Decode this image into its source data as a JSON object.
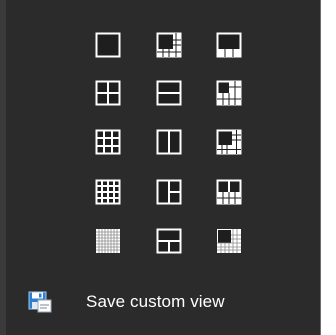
{
  "layout_menu": {
    "rows": [
      [
        "single-view-layout-icon",
        "one-plus-five-layout-icon",
        "one-plus-three-layout-icon"
      ],
      [
        "quad-grid-layout-icon",
        "horizontal-split-layout-icon",
        "one-plus-seven-layout-icon"
      ],
      [
        "nine-grid-layout-icon",
        "vertical-split-layout-icon",
        "one-plus-twelve-layout-icon"
      ],
      [
        "sixteen-grid-layout-icon",
        "left-large-split-layout-icon",
        "two-plus-eight-layout-icon"
      ],
      [
        "sixty-four-grid-layout-icon",
        "top-large-split-layout-icon",
        "one-plus-fifteen-layout-icon"
      ]
    ]
  },
  "save_custom_view": {
    "label": "Save custom view",
    "icon": "save-floppy-icon"
  },
  "colors": {
    "panel_bg": "#2b2b2b",
    "icon_fg": "#ffffff",
    "icon_fill": "#1e1e1e",
    "save_icon_blue": "#2f7fd1"
  }
}
